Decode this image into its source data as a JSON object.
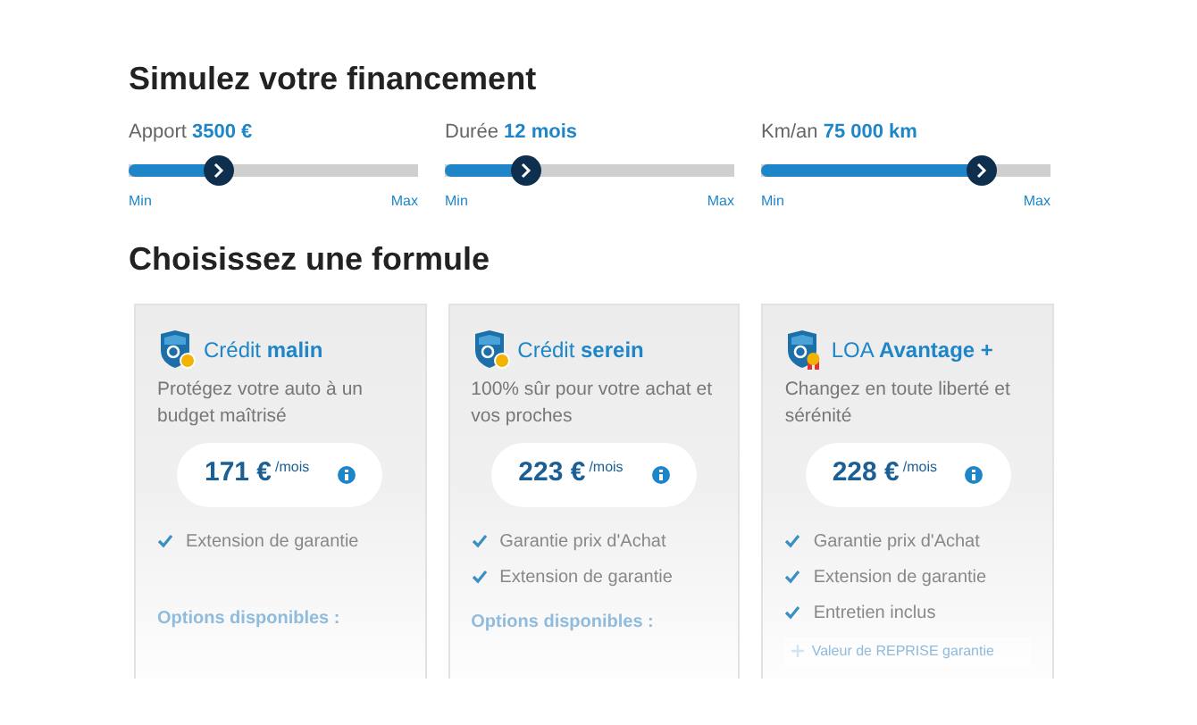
{
  "title": "Simulez votre financement",
  "sliders": [
    {
      "label": "Apport",
      "value": "3500 €",
      "level": 0.31,
      "min": "Min",
      "max": "Max"
    },
    {
      "label": "Durée",
      "value": "12 mois",
      "level": 0.28,
      "min": "Min",
      "max": "Max"
    },
    {
      "label": "Km/an",
      "value": "75 000 km",
      "level": 0.76,
      "min": "Min",
      "max": "Max"
    }
  ],
  "formula_title": "Choisissez une formule",
  "cards": [
    {
      "name": "Crédit **malin**",
      "kind": "euro",
      "description": "Protégez votre auto à un budget maîtrisé",
      "price": "171 €",
      "unit": "/mois",
      "features": [
        "Extension de garantie"
      ],
      "options_title": "Options disponibles :"
    },
    {
      "name": "Crédit **serein**",
      "kind": "euro",
      "description": "100% sûr pour votre achat et vos proches",
      "price": "223 €",
      "unit": "/mois",
      "features": [
        "Garantie prix d'Achat",
        "Extension de garantie"
      ],
      "options_title": "Options disponibles :"
    },
    {
      "name": "LOA **Avantage +**",
      "kind": "medal",
      "description": "Changez en toute liberté et sérénité",
      "price": "228 €",
      "unit": "/mois",
      "features": [
        "Garantie prix d'Achat",
        "Extension de garantie",
        "Entretien inclus"
      ],
      "option_button": "Valeur de REPRISE garantie"
    }
  ]
}
